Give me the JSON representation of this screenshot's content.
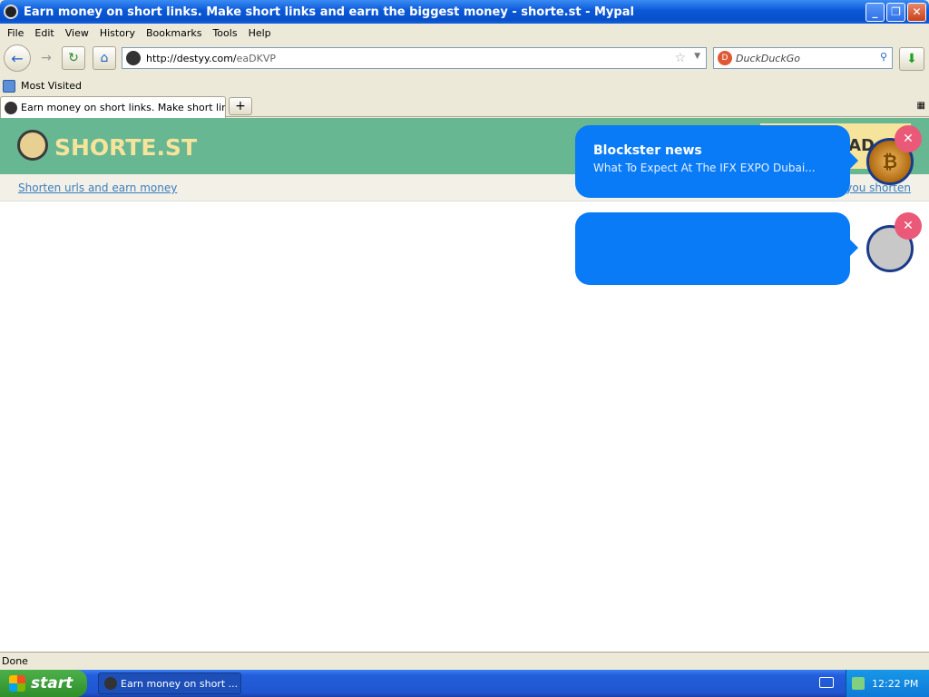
{
  "window": {
    "title": "Earn money on short links. Make short links and earn the biggest money - shorte.st - Mypal",
    "minimize": "_",
    "maximize": "❐",
    "close": "✕"
  },
  "menu": [
    "File",
    "Edit",
    "View",
    "History",
    "Bookmarks",
    "Tools",
    "Help"
  ],
  "toolbar": {
    "url_main": "http://destyy.com/",
    "url_path": "eaDKVP",
    "search_placeholder": "DuckDuckGo"
  },
  "bookmarks": {
    "item": "Most Visited"
  },
  "tabs": {
    "active": "Earn money on short links. Make short links ...",
    "new_tab": "+"
  },
  "page": {
    "logo": "SHORTE.ST",
    "ad_text": "AD",
    "tagline": "Shorten urls and earn money",
    "right_link": "you shorten"
  },
  "notifications": [
    {
      "title": "Blockster news",
      "body": "What To Expect At The IFX EXPO Dubai...",
      "avatar": "bitcoin-coin"
    },
    {
      "title": "",
      "body": "",
      "avatar": "blank"
    }
  ],
  "status": "Done",
  "taskbar": {
    "start": "start",
    "task": "Earn money on short ...",
    "clock": "12:22 PM"
  }
}
